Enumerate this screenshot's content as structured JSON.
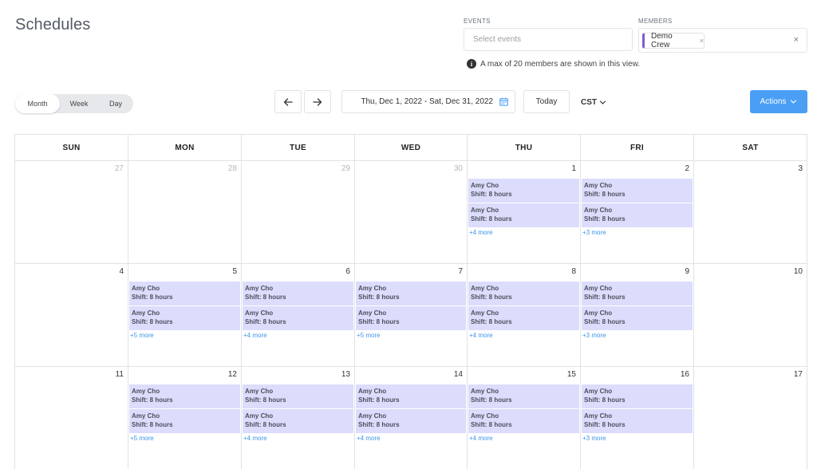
{
  "header": {
    "title": "Schedules"
  },
  "filters": {
    "events_label": "EVENTS",
    "events_placeholder": "Select events",
    "members_label": "MEMBERS",
    "member_chip": "Demo Crew",
    "chip_remove": "×",
    "clear": "×",
    "note": "A max of 20 members are shown in this view."
  },
  "toolbar": {
    "views": [
      "Month",
      "Week",
      "Day"
    ],
    "active_view": "Month",
    "date_range": "Thu, Dec 1, 2022 - Sat, Dec 31, 2022",
    "today": "Today",
    "timezone": "CST",
    "actions": "Actions"
  },
  "colors": {
    "accent": "#4a9ff5",
    "event_bg": "#dcdcfc",
    "member_stripe": "#7c5cd6",
    "more_link": "#3e95e8"
  },
  "icons": {
    "prev": "arrow-left-icon",
    "next": "arrow-right-icon",
    "calendar": "calendar-icon",
    "info": "info-icon",
    "chevron": "chevron-down-icon"
  },
  "calendar": {
    "weekdays": [
      "SUN",
      "MON",
      "TUE",
      "WED",
      "THU",
      "FRI",
      "SAT"
    ],
    "weeks": [
      [
        {
          "date": "27",
          "other": true,
          "events": [],
          "more": ""
        },
        {
          "date": "28",
          "other": true,
          "events": [],
          "more": ""
        },
        {
          "date": "29",
          "other": true,
          "events": [],
          "more": ""
        },
        {
          "date": "30",
          "other": true,
          "events": [],
          "more": ""
        },
        {
          "date": "1",
          "events": [
            {
              "name": "Amy Cho",
              "shift": "Shift: 8 hours"
            },
            {
              "name": "Amy Cho",
              "shift": "Shift: 8 hours"
            }
          ],
          "more": "+4 more"
        },
        {
          "date": "2",
          "events": [
            {
              "name": "Amy Cho",
              "shift": "Shift: 8 hours"
            },
            {
              "name": "Amy Cho",
              "shift": "Shift: 8 hours"
            }
          ],
          "more": "+3 more"
        },
        {
          "date": "3",
          "events": [],
          "more": ""
        }
      ],
      [
        {
          "date": "4",
          "events": [],
          "more": ""
        },
        {
          "date": "5",
          "events": [
            {
              "name": "Amy Cho",
              "shift": "Shift: 8 hours"
            },
            {
              "name": "Amy Cho",
              "shift": "Shift: 8 hours"
            }
          ],
          "more": "+5 more"
        },
        {
          "date": "6",
          "events": [
            {
              "name": "Amy Cho",
              "shift": "Shift: 8 hours"
            },
            {
              "name": "Amy Cho",
              "shift": "Shift: 8 hours"
            }
          ],
          "more": "+4 more"
        },
        {
          "date": "7",
          "events": [
            {
              "name": "Amy Cho",
              "shift": "Shift: 8 hours"
            },
            {
              "name": "Amy Cho",
              "shift": "Shift: 8 hours"
            }
          ],
          "more": "+5 more"
        },
        {
          "date": "8",
          "events": [
            {
              "name": "Amy Cho",
              "shift": "Shift: 8 hours"
            },
            {
              "name": "Amy Cho",
              "shift": "Shift: 8 hours"
            }
          ],
          "more": "+4 more"
        },
        {
          "date": "9",
          "events": [
            {
              "name": "Amy Cho",
              "shift": "Shift: 8 hours"
            },
            {
              "name": "Amy Cho",
              "shift": "Shift: 8 hours"
            }
          ],
          "more": "+3 more"
        },
        {
          "date": "10",
          "events": [],
          "more": ""
        }
      ],
      [
        {
          "date": "11",
          "events": [],
          "more": ""
        },
        {
          "date": "12",
          "events": [
            {
              "name": "Amy Cho",
              "shift": "Shift: 8 hours"
            },
            {
              "name": "Amy Cho",
              "shift": "Shift: 8 hours"
            }
          ],
          "more": "+5 more"
        },
        {
          "date": "13",
          "events": [
            {
              "name": "Amy Cho",
              "shift": "Shift: 8 hours"
            },
            {
              "name": "Amy Cho",
              "shift": "Shift: 8 hours"
            }
          ],
          "more": "+4 more"
        },
        {
          "date": "14",
          "events": [
            {
              "name": "Amy Cho",
              "shift": "Shift: 8 hours"
            },
            {
              "name": "Amy Cho",
              "shift": "Shift: 8 hours"
            }
          ],
          "more": "+4 more"
        },
        {
          "date": "15",
          "events": [
            {
              "name": "Amy Cho",
              "shift": "Shift: 8 hours"
            },
            {
              "name": "Amy Cho",
              "shift": "Shift: 8 hours"
            }
          ],
          "more": "+4 more"
        },
        {
          "date": "16",
          "events": [
            {
              "name": "Amy Cho",
              "shift": "Shift: 8 hours"
            },
            {
              "name": "Amy Cho",
              "shift": "Shift: 8 hours"
            }
          ],
          "more": "+3 more"
        },
        {
          "date": "17",
          "events": [],
          "more": ""
        }
      ]
    ]
  }
}
